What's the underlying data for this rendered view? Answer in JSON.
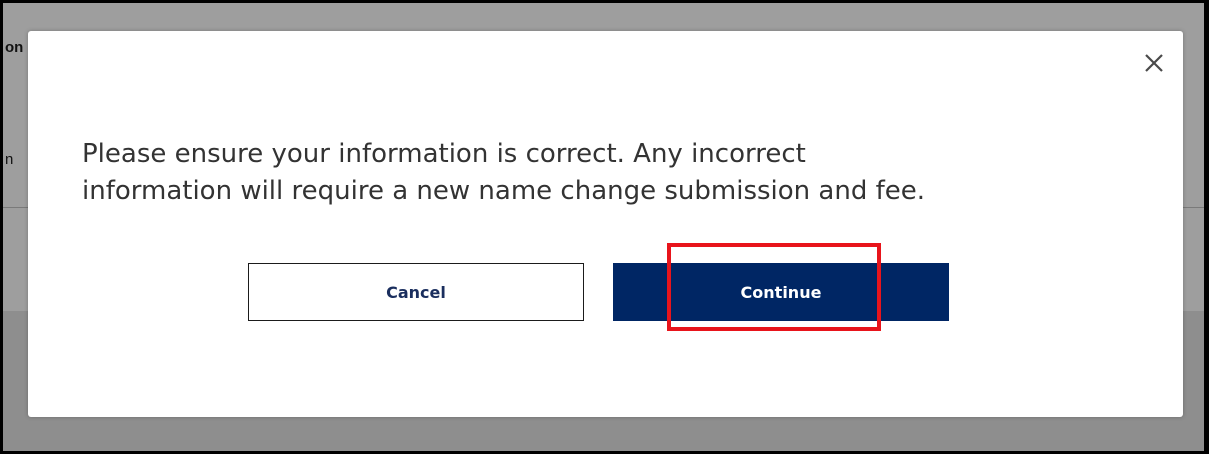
{
  "page_background": {
    "snippet_top": "on",
    "snippet_middle": "n"
  },
  "modal": {
    "message_line1": "Please ensure your information is correct. Any incorrect",
    "message_line2": "information will require a new name change submission and fee.",
    "close_icon": "close-icon",
    "buttons": {
      "cancel_label": "Cancel",
      "continue_label": "Continue"
    }
  },
  "colors": {
    "primary_button": "#002664",
    "cancel_text": "#1a2e5e",
    "highlight": "#e8141b",
    "overlay": "rgba(40,40,40,0.45)"
  }
}
